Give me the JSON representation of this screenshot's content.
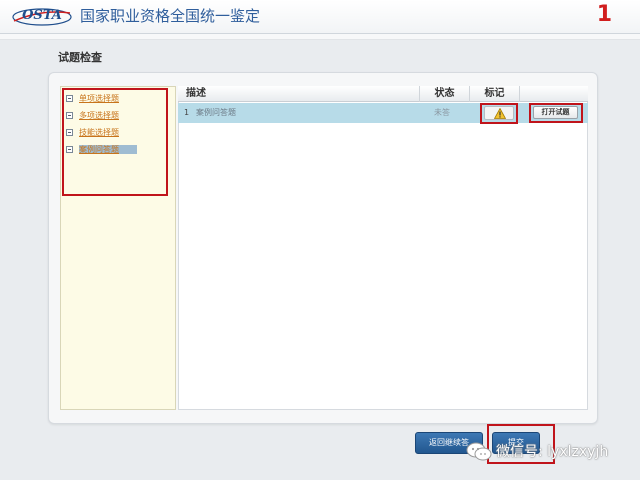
{
  "header": {
    "logo_text": "OSTA",
    "title": "国家职业资格全国统一鉴定",
    "page_number": "1"
  },
  "section": {
    "title": "试题检查"
  },
  "tree": {
    "items": [
      {
        "label": "单项选择题",
        "active": false
      },
      {
        "label": "多项选择题",
        "active": false
      },
      {
        "label": "技能选择题",
        "active": false
      },
      {
        "label": "案例问答题",
        "active": true
      }
    ]
  },
  "table": {
    "columns": [
      "描述",
      "状态",
      "标记",
      ""
    ],
    "rows": [
      {
        "index": "1",
        "description": "案例问答题",
        "status": "未答",
        "mark_icon": "warning-icon",
        "action": "打开试题"
      }
    ]
  },
  "buttons": {
    "back": "返回继续答",
    "submit": "提交"
  },
  "watermark": {
    "text": "微信号: lyxlzxyjh",
    "icon": "wechat-icon"
  },
  "colors": {
    "accent": "#2f5e9c",
    "highlight_row": "#b7dbe8",
    "annotation_red": "#c0141b",
    "tree_link": "#c8741b",
    "button_blue": "#22578f"
  }
}
